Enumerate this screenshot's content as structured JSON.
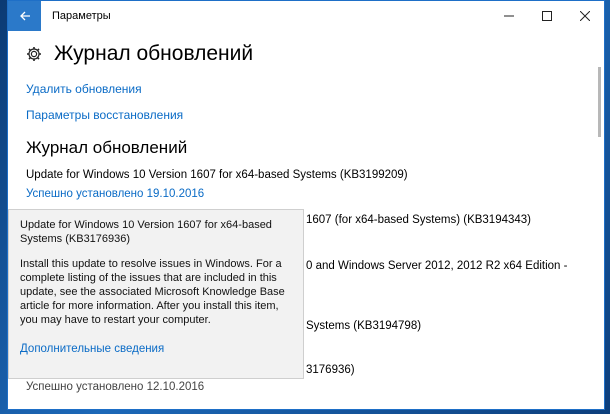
{
  "window": {
    "title": "Параметры",
    "back_icon": "arrow-left",
    "controls": [
      "—",
      "☐",
      "✕"
    ]
  },
  "page": {
    "title": "Журнал обновлений",
    "icon": "gear-icon"
  },
  "links": {
    "uninstall": "Удалить обновления",
    "recovery": "Параметры восстановления"
  },
  "section": {
    "title": "Журнал обновлений"
  },
  "updates": [
    {
      "name": "Update for Windows 10 Version 1607 for x64-based Systems (KB3199209)",
      "status": "Успешно установлено 19.10.2016"
    },
    {
      "name": "1607 (for x64-based Systems) (KB3194343)"
    },
    {
      "name": "0 and Windows Server 2012, 2012 R2 x64 Edition -"
    },
    {
      "name": "Systems (KB3194798)"
    },
    {
      "name": "3176936)",
      "status": "Успешно установлено 12.10.2016"
    }
  ],
  "tooltip": {
    "title": "Update for Windows 10 Version 1607 for x64-based Systems (KB3176936)",
    "body": "Install this update to resolve issues in Windows. For a complete listing of the issues that are included in this update, see the associated Microsoft Knowledge Base article for more information. After you install this item, you may have to restart your computer.",
    "link": "Дополнительные сведения"
  },
  "colors": {
    "accent": "#0a6bc6",
    "titlebar_back": "#2b79c9",
    "tooltip_bg": "#f2f2f2"
  }
}
